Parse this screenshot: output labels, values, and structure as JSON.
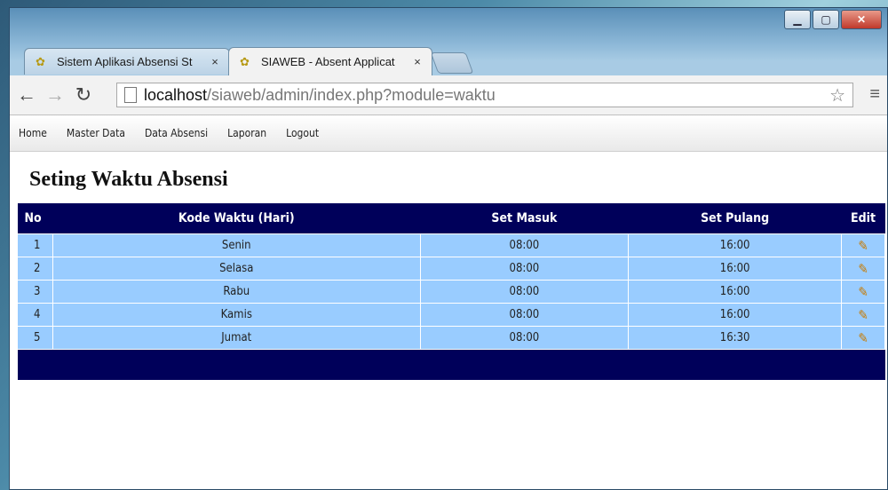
{
  "tabs": [
    {
      "title": "Sistem Aplikasi Absensi St"
    },
    {
      "title": "SIAWEB - Absent Applicat"
    }
  ],
  "tab_close_glyph": "×",
  "address": {
    "host": "localhost",
    "path": "/siaweb/admin/index.php?module=waktu"
  },
  "nav": {
    "items": [
      "Home",
      "Master Data",
      "Data Absensi",
      "Laporan",
      "Logout"
    ]
  },
  "page": {
    "title": "Seting Waktu Absensi"
  },
  "table": {
    "headers": [
      "No",
      "Kode Waktu (Hari)",
      "Set Masuk",
      "Set Pulang",
      "Edit"
    ],
    "rows": [
      {
        "no": "1",
        "hari": "Senin",
        "masuk": "08:00",
        "pulang": "16:00"
      },
      {
        "no": "2",
        "hari": "Selasa",
        "masuk": "08:00",
        "pulang": "16:00"
      },
      {
        "no": "3",
        "hari": "Rabu",
        "masuk": "08:00",
        "pulang": "16:00"
      },
      {
        "no": "4",
        "hari": "Kamis",
        "masuk": "08:00",
        "pulang": "16:00"
      },
      {
        "no": "5",
        "hari": "Jumat",
        "masuk": "08:00",
        "pulang": "16:30"
      }
    ]
  },
  "colors": {
    "header_bg": "#00005a",
    "row_bg": "#99ccff"
  },
  "icons": {
    "edit": "edit-pencil-icon",
    "favicon": "siaweb-favicon-icon"
  }
}
